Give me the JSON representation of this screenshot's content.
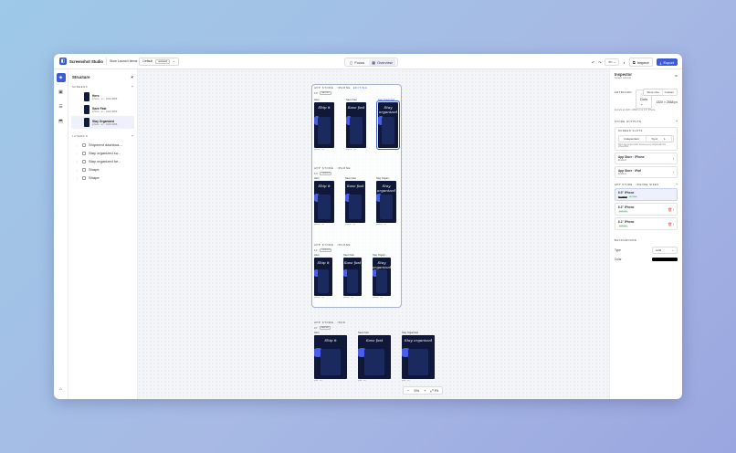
{
  "topbar": {
    "app_title": "Screenshot Studio",
    "doc_name": "Slow Launch Items",
    "profile": "Default",
    "profile_badge": "unsaved",
    "modes": [
      "Focus",
      "Overview"
    ],
    "language": "en",
    "inspect_label": "Inspect",
    "export_label": "Export"
  },
  "structure": {
    "title": "Structure",
    "screens_label": "SCREENS",
    "screens": [
      {
        "name": "Hero",
        "meta": "iphone · en · 1320×2868"
      },
      {
        "name": "Save Fast",
        "meta": "iphone · en · 1320×2868"
      },
      {
        "name": "Stay Organized",
        "meta": "iphone · en · 1320×2868"
      }
    ],
    "layers_label": "LAYERS",
    "layers_count": "5",
    "layers": [
      "Shipment dashboa...",
      "Stay organized su...",
      "Stay organized he...",
      "Shape",
      "Shape"
    ]
  },
  "canvas": {
    "dots_label": "Dots",
    "zoom": "5%",
    "fit_label": "Fit",
    "groups": [
      {
        "head": "APP STORE · IPHONE",
        "link": "EDITING",
        "sub": "6.9\"",
        "badge": "MASTER",
        "phones": [
          {
            "label": "Hero",
            "title": "Ship it",
            "foot": "iphone · en"
          },
          {
            "label": "Save Fast",
            "title": "Save fast",
            "foot": "iphone · en"
          },
          {
            "label": "Stay Organized",
            "title": "Stay organized",
            "foot": "iphone · en"
          }
        ]
      },
      {
        "head": "APP STORE · IPHONE",
        "link": "",
        "sub": "6.3\"",
        "badge": "DERIVED",
        "phones": [
          {
            "label": "Hero",
            "title": "Ship it",
            "foot": "iphone · en"
          },
          {
            "label": "Save Fast",
            "title": "Save fast",
            "foot": "iphone · en"
          },
          {
            "label": "Stay Organi...",
            "title": "Stay organized",
            "foot": "iphone · en"
          }
        ]
      },
      {
        "head": "APP STORE · IPHONE",
        "link": "",
        "sub": "6.1\"",
        "badge": "DERIVED",
        "phones": [
          {
            "label": "Hero",
            "title": "Ship it",
            "foot": "iphone · en"
          },
          {
            "label": "Save Fast",
            "title": "Save fast",
            "foot": "iphone · en"
          },
          {
            "label": "Stay Organi...",
            "title": "Stay organized",
            "foot": "iphone · en"
          }
        ]
      },
      {
        "head": "APP STORE · IPAD",
        "link": "",
        "sub": "13\"",
        "badge": "MASTER",
        "phones": [
          {
            "label": "Hero",
            "title": "Ship it",
            "foot": "ipad · en"
          },
          {
            "label": "Save Fast",
            "title": "Save fast",
            "foot": "ipad · en"
          },
          {
            "label": "Stay Organized",
            "title": "Stay organized",
            "foot": "ipad · en"
          }
        ]
      }
    ]
  },
  "inspector": {
    "title": "Inspector",
    "subtitle": "Screen settings",
    "artboard_label": "ARTBOARD",
    "artboard_opts": [
      "Store size",
      "Custom"
    ],
    "size_value": "1320 × 2868 px",
    "export_note": "Exports at 1320 × 2868 px for 6.9\" iPhone.",
    "store_outputs_label": "STORE OUTPUTS",
    "screen_slots_label": "SCREEN SLOTS",
    "slot_opts": [
      "Independent",
      "Sync"
    ],
    "slot_count": "1",
    "slot_hint": "Sync layers and order across every output with this screenshot.",
    "outputs": [
      {
        "name": "App Store · iPhone",
        "status": "Enabled"
      },
      {
        "name": "App Store · iPad",
        "status": "Enabled"
      }
    ],
    "sizes_label": "APP STORE · IPHONE SIZES",
    "sizes": [
      {
        "name": "6.9\" iPhone",
        "tags": [
          "MASTER",
          "EDITING"
        ]
      },
      {
        "name": "6.3\" iPhone",
        "tags": [
          "DERIVED"
        ]
      },
      {
        "name": "6.1\" iPhone",
        "tags": [
          "DERIVED"
        ]
      }
    ],
    "background_label": "BACKGROUND",
    "type_label": "Type",
    "type_value": "solid",
    "color_label": "Color",
    "accent": "#3b5bd6"
  }
}
